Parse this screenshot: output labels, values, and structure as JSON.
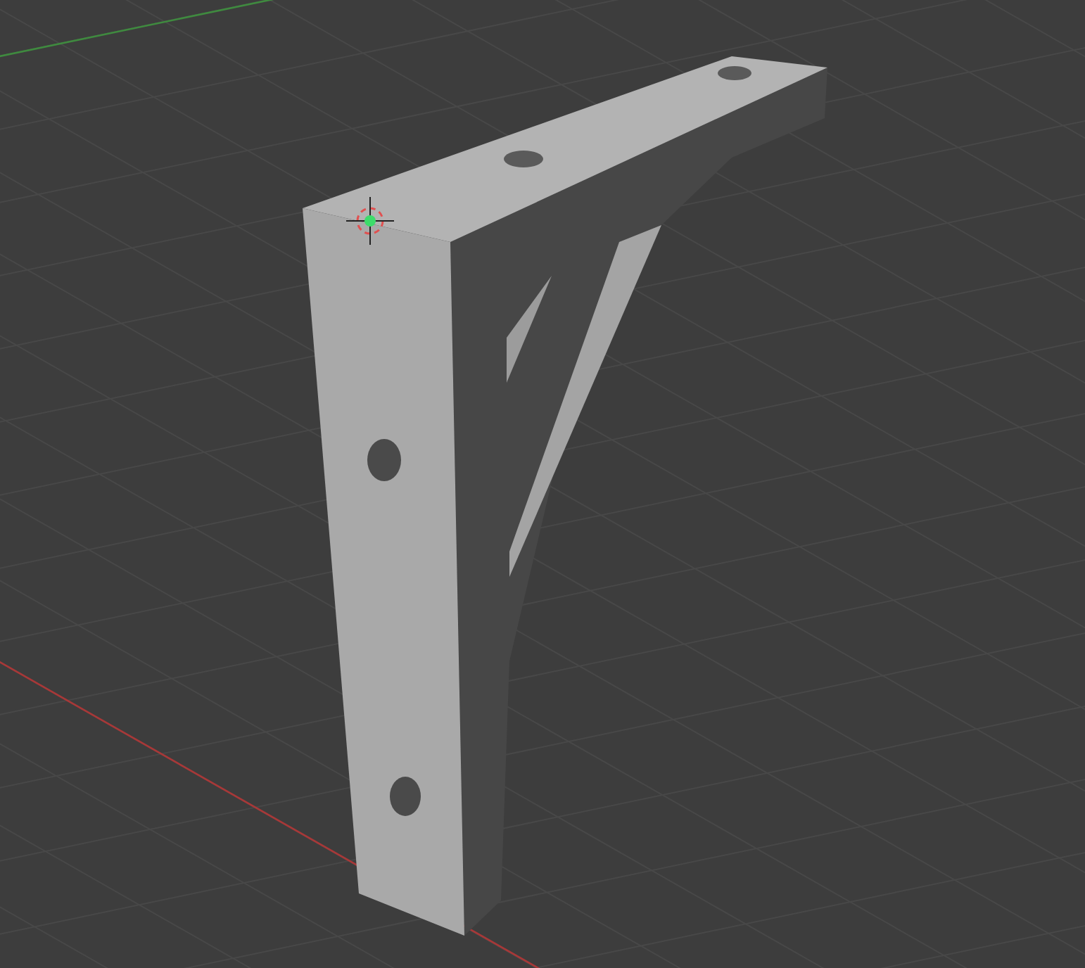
{
  "viewport": {
    "axes": [
      {
        "kind": "x",
        "color": "#a83838"
      },
      {
        "kind": "y",
        "color": "#3f8a3f"
      }
    ]
  }
}
